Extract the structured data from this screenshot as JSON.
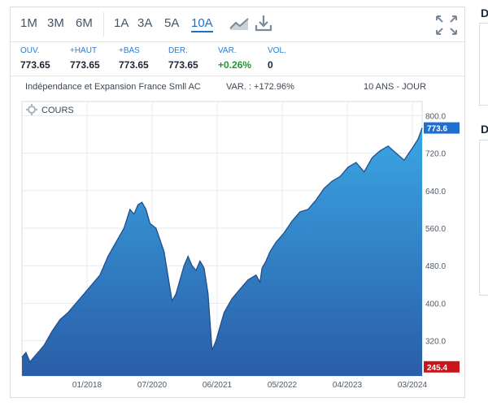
{
  "toolbar": {
    "periods": [
      "1M",
      "3M",
      "6M",
      "1A",
      "3A",
      "5A",
      "10A"
    ],
    "active_period": "10A",
    "icons": [
      "chart-type-icon",
      "download-icon",
      "expand-icon"
    ]
  },
  "quote": [
    {
      "label": "OUV.",
      "value": "773.65"
    },
    {
      "label": "+HAUT",
      "value": "773.65"
    },
    {
      "label": "+BAS",
      "value": "773.65"
    },
    {
      "label": "DER.",
      "value": "773.65"
    },
    {
      "label": "VAR.",
      "value": "+0.26%"
    },
    {
      "label": "VOL.",
      "value": "0"
    }
  ],
  "chart_header": {
    "name": "Indépendance et Expansion France Smll AC",
    "variation": "VAR. : +172.96%",
    "range": "10 ANS - JOUR"
  },
  "side_panels": [
    {
      "title": "D"
    },
    {
      "title": "D"
    }
  ],
  "colors": {
    "accent": "#1e6fd1",
    "area_top": "#3aa6e3",
    "area_bottom": "#2a5da8",
    "line": "#1f4f8f",
    "last_badge": "#1e6fd1",
    "min_badge": "#c8161d",
    "positive": "#1f9a2e"
  },
  "chart_data": {
    "type": "area",
    "series_label": "COURS",
    "x_ticks": [
      "01/2018",
      "07/2020",
      "06/2021",
      "05/2022",
      "04/2023",
      "03/2024"
    ],
    "x_range": [
      2014.25,
      2024.25
    ],
    "ylim": [
      245,
      830
    ],
    "y_ticks": [
      320.0,
      400.0,
      480.0,
      560.0,
      640.0,
      720.0,
      800.0
    ],
    "last_value": 773.6,
    "last_label": "773.6",
    "min_value": 245.4,
    "min_label": "245.4",
    "grid": true,
    "x": [
      2014.25,
      2014.35,
      2014.45,
      2014.6,
      2014.8,
      2015.0,
      2015.2,
      2015.4,
      2015.6,
      2015.8,
      2016.0,
      2016.2,
      2016.4,
      2016.6,
      2016.8,
      2016.95,
      2017.05,
      2017.15,
      2017.25,
      2017.35,
      2017.45,
      2017.6,
      2017.8,
      2018.0,
      2018.1,
      2018.2,
      2018.3,
      2018.4,
      2018.5,
      2018.6,
      2018.7,
      2018.8,
      2018.9,
      2019.0,
      2019.1,
      2019.2,
      2019.3,
      2019.4,
      2019.5,
      2019.6,
      2019.7,
      2019.8,
      2019.9,
      2020.0,
      2020.1,
      2020.2,
      2020.25,
      2020.35,
      2020.45,
      2020.6,
      2020.8,
      2021.0,
      2021.2,
      2021.4,
      2021.6,
      2021.8,
      2022.0,
      2022.2,
      2022.4,
      2022.6,
      2022.8,
      2023.0,
      2023.2,
      2023.4,
      2023.6,
      2023.8,
      2024.0,
      2024.15,
      2024.25
    ],
    "values": [
      285,
      295,
      275,
      290,
      310,
      340,
      365,
      380,
      400,
      420,
      440,
      460,
      500,
      530,
      560,
      600,
      590,
      610,
      615,
      600,
      570,
      560,
      510,
      405,
      420,
      450,
      480,
      500,
      480,
      470,
      490,
      475,
      420,
      300,
      320,
      350,
      380,
      395,
      410,
      420,
      430,
      440,
      450,
      455,
      460,
      445,
      475,
      490,
      510,
      530,
      550,
      575,
      595,
      600,
      620,
      645,
      660,
      670,
      690,
      700,
      680,
      710,
      725,
      735,
      720,
      705,
      730,
      750,
      773.6
    ]
  }
}
